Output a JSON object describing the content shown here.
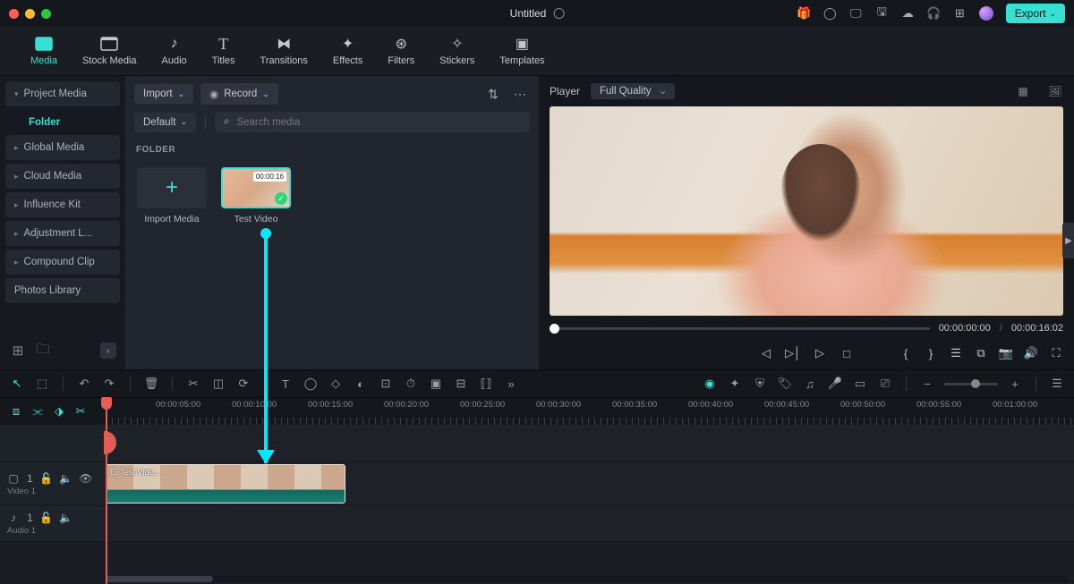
{
  "titlebar": {
    "title": "Untitled",
    "export": "Export"
  },
  "main_tabs": [
    {
      "id": "media",
      "label": "Media",
      "active": true
    },
    {
      "id": "stock",
      "label": "Stock Media"
    },
    {
      "id": "audio",
      "label": "Audio"
    },
    {
      "id": "titles",
      "label": "Titles"
    },
    {
      "id": "transitions",
      "label": "Transitions"
    },
    {
      "id": "effects",
      "label": "Effects"
    },
    {
      "id": "filters",
      "label": "Filters"
    },
    {
      "id": "stickers",
      "label": "Stickers"
    },
    {
      "id": "templates",
      "label": "Templates"
    }
  ],
  "sidebar": {
    "items": [
      {
        "label": "Project Media",
        "expanded": true
      },
      {
        "label": "Global Media"
      },
      {
        "label": "Cloud Media"
      },
      {
        "label": "Influence Kit"
      },
      {
        "label": "Adjustment L..."
      },
      {
        "label": "Compound Clip"
      },
      {
        "label": "Photos Library"
      }
    ],
    "sub": "Folder"
  },
  "media_panel": {
    "import": "Import",
    "record": "Record",
    "default": "Default",
    "search_placeholder": "Search media",
    "section": "FOLDER",
    "cards": [
      {
        "label": "Import Media",
        "type": "add"
      },
      {
        "label": "Test Video",
        "type": "video",
        "duration": "00:00:16"
      }
    ]
  },
  "player": {
    "tab": "Player",
    "quality": "Full Quality",
    "current": "00:00:00:00",
    "total": "00:00:16:02"
  },
  "timeline_ruler": [
    "00:00:05:00",
    "00:00:10:00",
    "00:00:15:00",
    "00:00:20:00",
    "00:00:25:00",
    "00:00:30:00",
    "00:00:35:00",
    "00:00:40:00",
    "00:00:45:00",
    "00:00:50:00",
    "00:00:55:00",
    "00:01:00:00"
  ],
  "tracks": {
    "video": {
      "name": "Video 1",
      "num": "1"
    },
    "audio": {
      "name": "Audio 1",
      "num": "1"
    },
    "clip_label": "Test Vide..."
  }
}
